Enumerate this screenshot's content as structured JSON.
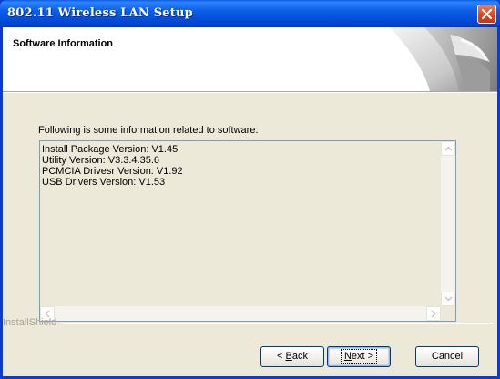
{
  "window": {
    "title": "802.11 Wireless LAN Setup"
  },
  "header": {
    "title": "Software Information"
  },
  "main": {
    "intro": "Following is some information related to software:",
    "info_lines": [
      "Install Package Version: V1.45",
      "Utility Version: V3.3.4.35.6",
      "PCMCIA Drivesr Version: V1.92",
      "USB Drivers Version: V1.53"
    ]
  },
  "footer": {
    "brand": "InstallShield",
    "back_label": "Back",
    "back_key": "B",
    "next_label": "Next >",
    "next_key": "N",
    "cancel_label": "Cancel"
  },
  "icons": {
    "close": "close-icon",
    "scroll_up": "scroll-up-icon",
    "scroll_down": "scroll-down-icon",
    "scroll_left": "scroll-left-icon",
    "scroll_right": "scroll-right-icon"
  },
  "colors": {
    "titlebar": "#0a5ae8",
    "client": "#ece9d8",
    "close": "#d6471f",
    "border": "#7f9db9"
  }
}
